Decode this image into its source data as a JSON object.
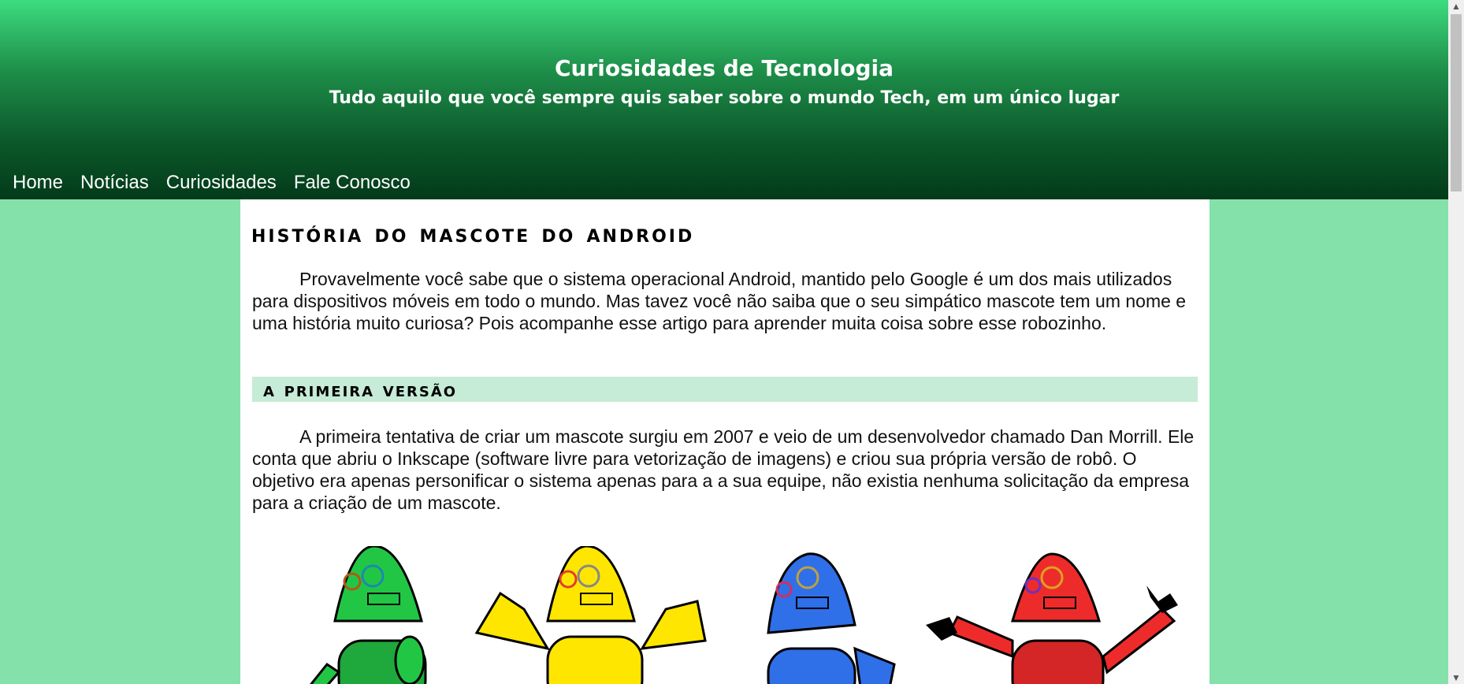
{
  "header": {
    "title": "Curiosidades de Tecnologia",
    "subtitle": "Tudo aquilo que você sempre quis saber sobre o mundo Tech, em um único lugar"
  },
  "nav": {
    "items": [
      {
        "label": "Home"
      },
      {
        "label": "Notícias"
      },
      {
        "label": "Curiosidades"
      },
      {
        "label": "Fale Conosco"
      }
    ]
  },
  "article": {
    "title": "História do Mascote do Android",
    "intro": "Provavelmente você sabe que o sistema operacional Android, mantido pelo Google é um dos mais utilizados para dispositivos móveis em todo o mundo. Mas tavez você não saiba que o seu simpático mascote tem um nome e uma história muito curiosa? Pois acompanhe esse artigo para aprender muita coisa sobre esse robozinho.",
    "section1": {
      "heading": "A Primeira Versão",
      "text": "A primeira tentativa de criar um mascote surgiu em 2007 e veio de um desenvolvedor chamado Dan Morrill. Ele conta que abriu o Inkscape (software livre para vetorização de imagens) e criou sua própria versão de robô. O objetivo era apenas personificar o sistema apenas para a a sua equipe, não existia nenhuma solicitação da empresa para a criação de um mascote."
    },
    "robot_colors": [
      "#22c645",
      "#ffe600",
      "#2f6fe8",
      "#ee2b2b"
    ]
  },
  "colors": {
    "page_background": "#85e1aa",
    "header_top": "#3ddc7f",
    "header_bottom": "#033a1a",
    "section_heading_bg": "#c6ebd6"
  }
}
